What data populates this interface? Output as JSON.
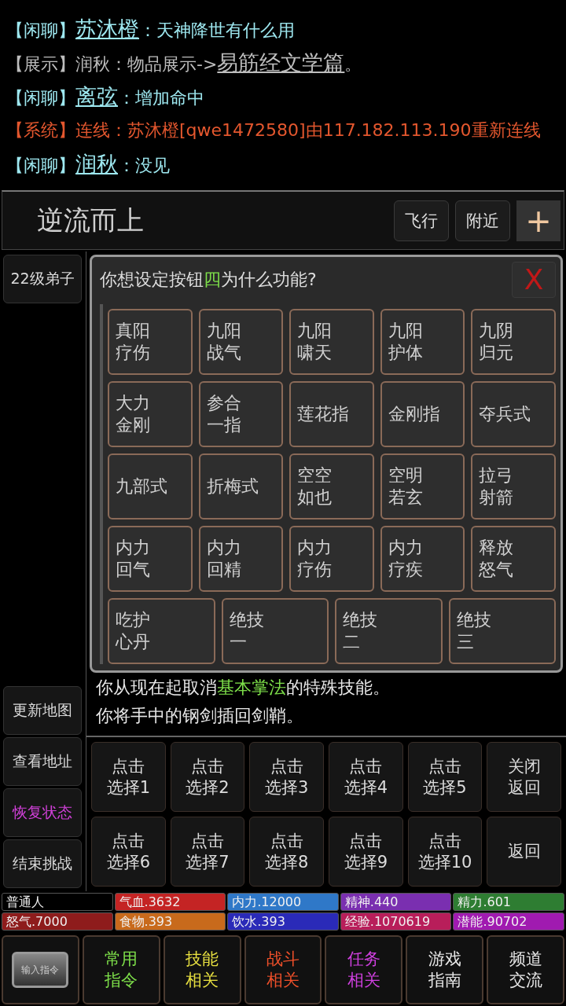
{
  "chat": [
    {
      "channel": "【闲聊】",
      "color": "#9ee8f0",
      "parts": [
        {
          "text": "苏沐橙",
          "link": true
        },
        {
          "text": "：天神降世有什么用",
          "link": false
        }
      ]
    },
    {
      "channel": "【展示】",
      "color": "#bdbdbd",
      "parts": [
        {
          "text": "润秋：物品展示->",
          "link": false
        },
        {
          "text": "易筋经文学篇",
          "link": true
        },
        {
          "text": "。",
          "link": false
        }
      ]
    },
    {
      "channel": "【闲聊】",
      "color": "#9ee8f0",
      "parts": [
        {
          "text": "离弦",
          "link": true
        },
        {
          "text": "：增加命中",
          "link": false
        }
      ]
    },
    {
      "channel": "【系统】",
      "color": "#e4572e",
      "parts": [
        {
          "text": "连线：苏沐橙[qwe1472580]由117.182.113.190重新连线",
          "link": false
        }
      ]
    },
    {
      "channel": "【闲聊】",
      "color": "#9ee8f0",
      "parts": [
        {
          "text": "润秋",
          "link": true
        },
        {
          "text": "：没见",
          "link": false
        }
      ]
    }
  ],
  "location": {
    "title": "逆流而上",
    "buttons": [
      "飞行",
      "附近"
    ],
    "add": "+"
  },
  "sidebar_top": "22级弟子",
  "dialog": {
    "title_before": "你想设定按钮",
    "title_highlight": "四",
    "title_after": "为什么功能?",
    "close": "X",
    "rows": [
      [
        [
          "真阳",
          "疗伤"
        ],
        [
          "九阳",
          "战气"
        ],
        [
          "九阳",
          "啸天"
        ],
        [
          "九阳",
          "护体"
        ],
        [
          "九阴",
          "归元"
        ]
      ],
      [
        [
          "大力",
          "金刚"
        ],
        [
          "参合",
          "一指"
        ],
        [
          "莲花指"
        ],
        [
          "金刚指"
        ],
        [
          "夺兵式"
        ]
      ],
      [
        [
          "九部式"
        ],
        [
          "折梅式"
        ],
        [
          "空空",
          "如也"
        ],
        [
          "空明",
          "若玄"
        ],
        [
          "拉弓",
          "射箭"
        ]
      ],
      [
        [
          "内力",
          "回气"
        ],
        [
          "内力",
          "回精"
        ],
        [
          "内力",
          "疗伤"
        ],
        [
          "内力",
          "疗疾"
        ],
        [
          "释放",
          "怒气"
        ]
      ],
      [
        [
          "吃护",
          "心丹"
        ],
        [
          "绝技",
          "一"
        ],
        [
          "绝技",
          "二"
        ],
        [
          "绝技",
          "三"
        ]
      ]
    ]
  },
  "messages": [
    {
      "parts": [
        {
          "text": "你从现在起取消",
          "highlight": false
        },
        {
          "text": "基本掌法",
          "highlight": true
        },
        {
          "text": "的特殊技能。",
          "highlight": false
        }
      ]
    },
    {
      "parts": [
        {
          "text": "你将手中的钢剑插回剑鞘。",
          "highlight": false
        }
      ]
    }
  ],
  "sidebar": [
    {
      "label": "更新地图",
      "color": "#d8d8d8"
    },
    {
      "label": "查看地址",
      "color": "#d8d8d8"
    },
    {
      "label": "恢复状态",
      "color": "#d040d8"
    },
    {
      "label": "结束挑战",
      "color": "#d8d8d8"
    }
  ],
  "choices": [
    [
      "点击",
      "选择1"
    ],
    [
      "点击",
      "选择2"
    ],
    [
      "点击",
      "选择3"
    ],
    [
      "点击",
      "选择4"
    ],
    [
      "点击",
      "选择5"
    ],
    [
      "关闭",
      "返回"
    ],
    [
      "点击",
      "选择6"
    ],
    [
      "点击",
      "选择7"
    ],
    [
      "点击",
      "选择8"
    ],
    [
      "点击",
      "选择9"
    ],
    [
      "点击",
      "选择10"
    ],
    [
      "返回"
    ]
  ],
  "stats": [
    {
      "label": "普通人",
      "color": "#000000"
    },
    {
      "label": "气血.3632",
      "color": "#c42424"
    },
    {
      "label": "内力.12000",
      "color": "#2f78c8"
    },
    {
      "label": "精神.440",
      "color": "#7a2fb0"
    },
    {
      "label": "精力.601",
      "color": "#2e7d32"
    },
    {
      "label": "怒气.7000",
      "color": "#8e1c1c"
    },
    {
      "label": "食物.393",
      "color": "#c86a1c"
    },
    {
      "label": "饮水.393",
      "color": "#2a2ab8"
    },
    {
      "label": "经验.1070619",
      "color": "#b81e5a"
    },
    {
      "label": "潜能.90702",
      "color": "#a01ab0"
    }
  ],
  "bottom": {
    "input": "输入指令",
    "tabs": [
      {
        "lines": [
          "常用",
          "指令"
        ],
        "color": "#7ee04a"
      },
      {
        "lines": [
          "技能",
          "相关"
        ],
        "color": "#e8e040"
      },
      {
        "lines": [
          "战斗",
          "相关"
        ],
        "color": "#f0502a"
      },
      {
        "lines": [
          "任务",
          "相关"
        ],
        "color": "#d040e0"
      },
      {
        "lines": [
          "游戏",
          "指南"
        ],
        "color": "#e8e8e8"
      },
      {
        "lines": [
          "频道",
          "交流"
        ],
        "color": "#e8e8e8"
      }
    ]
  }
}
